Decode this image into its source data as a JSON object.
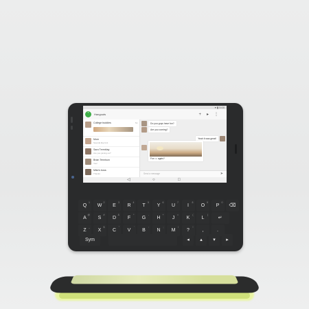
{
  "app": {
    "title": "Hangouts",
    "logo": "\""
  },
  "status": {
    "icons": "▾ ▮ 5:00"
  },
  "appbar_actions": [
    "+",
    "▸",
    "⋮"
  ],
  "conversations": [
    {
      "name": "College buddies",
      "sub": "",
      "time": "5m",
      "has_image": true
    },
    {
      "name": "Mom",
      "sub": "Sounds like fun!",
      "time": "",
      "has_image": false
    },
    {
      "name": "Sara Tremblay",
      "sub": "Are you joining us?",
      "time": "",
      "has_image": false
    },
    {
      "name": "Brian Tennison",
      "sub": "Yes!",
      "time": "",
      "has_image": false
    },
    {
      "name": "Mike's boss",
      "sub": "Thanks",
      "time": "",
      "has_image": false
    }
  ],
  "chat": {
    "messages": [
      {
        "text": "Do you guys have fun?",
        "side": "left"
      },
      {
        "text": "Are you coming?",
        "side": "left"
      },
      {
        "text": "Yeah it was great!",
        "side": "right"
      }
    ],
    "photo_caption": "Fun ☺ again?",
    "input_placeholder": "Send a message"
  },
  "navbar": [
    "◁",
    "○",
    "□"
  ],
  "keyboard": {
    "row1": [
      {
        "k": "Q",
        "s": "1"
      },
      {
        "k": "W",
        "s": "2"
      },
      {
        "k": "E",
        "s": "3"
      },
      {
        "k": "R",
        "s": "4"
      },
      {
        "k": "T",
        "s": "5"
      },
      {
        "k": "Y",
        "s": "6"
      },
      {
        "k": "U",
        "s": "7"
      },
      {
        "k": "I",
        "s": "8"
      },
      {
        "k": "O",
        "s": "9"
      },
      {
        "k": "P",
        "s": "0"
      },
      {
        "k": "⌫",
        "s": ""
      }
    ],
    "row2": [
      {
        "k": "A",
        "s": "@"
      },
      {
        "k": "S",
        "s": "#"
      },
      {
        "k": "D",
        "s": "&"
      },
      {
        "k": "F",
        "s": "*"
      },
      {
        "k": "G",
        "s": "-"
      },
      {
        "k": "H",
        "s": "+"
      },
      {
        "k": "J",
        "s": "="
      },
      {
        "k": "K",
        "s": "("
      },
      {
        "k": "L",
        "s": ")"
      },
      {
        "k": "↵",
        "s": ""
      }
    ],
    "row3": [
      {
        "k": "Z",
        "s": "_"
      },
      {
        "k": "X",
        "s": "$"
      },
      {
        "k": "C",
        "s": "\""
      },
      {
        "k": "V",
        "s": "'"
      },
      {
        "k": "B",
        "s": ":"
      },
      {
        "k": "N",
        "s": ";"
      },
      {
        "k": "M",
        "s": "/"
      },
      {
        "k": "?",
        "s": "!"
      },
      {
        "k": ",",
        "s": ""
      },
      {
        "k": ".",
        "s": ""
      }
    ],
    "row4": {
      "sym": "Sym",
      "arrows": [
        "◂",
        "▴",
        "▾",
        "▸"
      ]
    }
  }
}
